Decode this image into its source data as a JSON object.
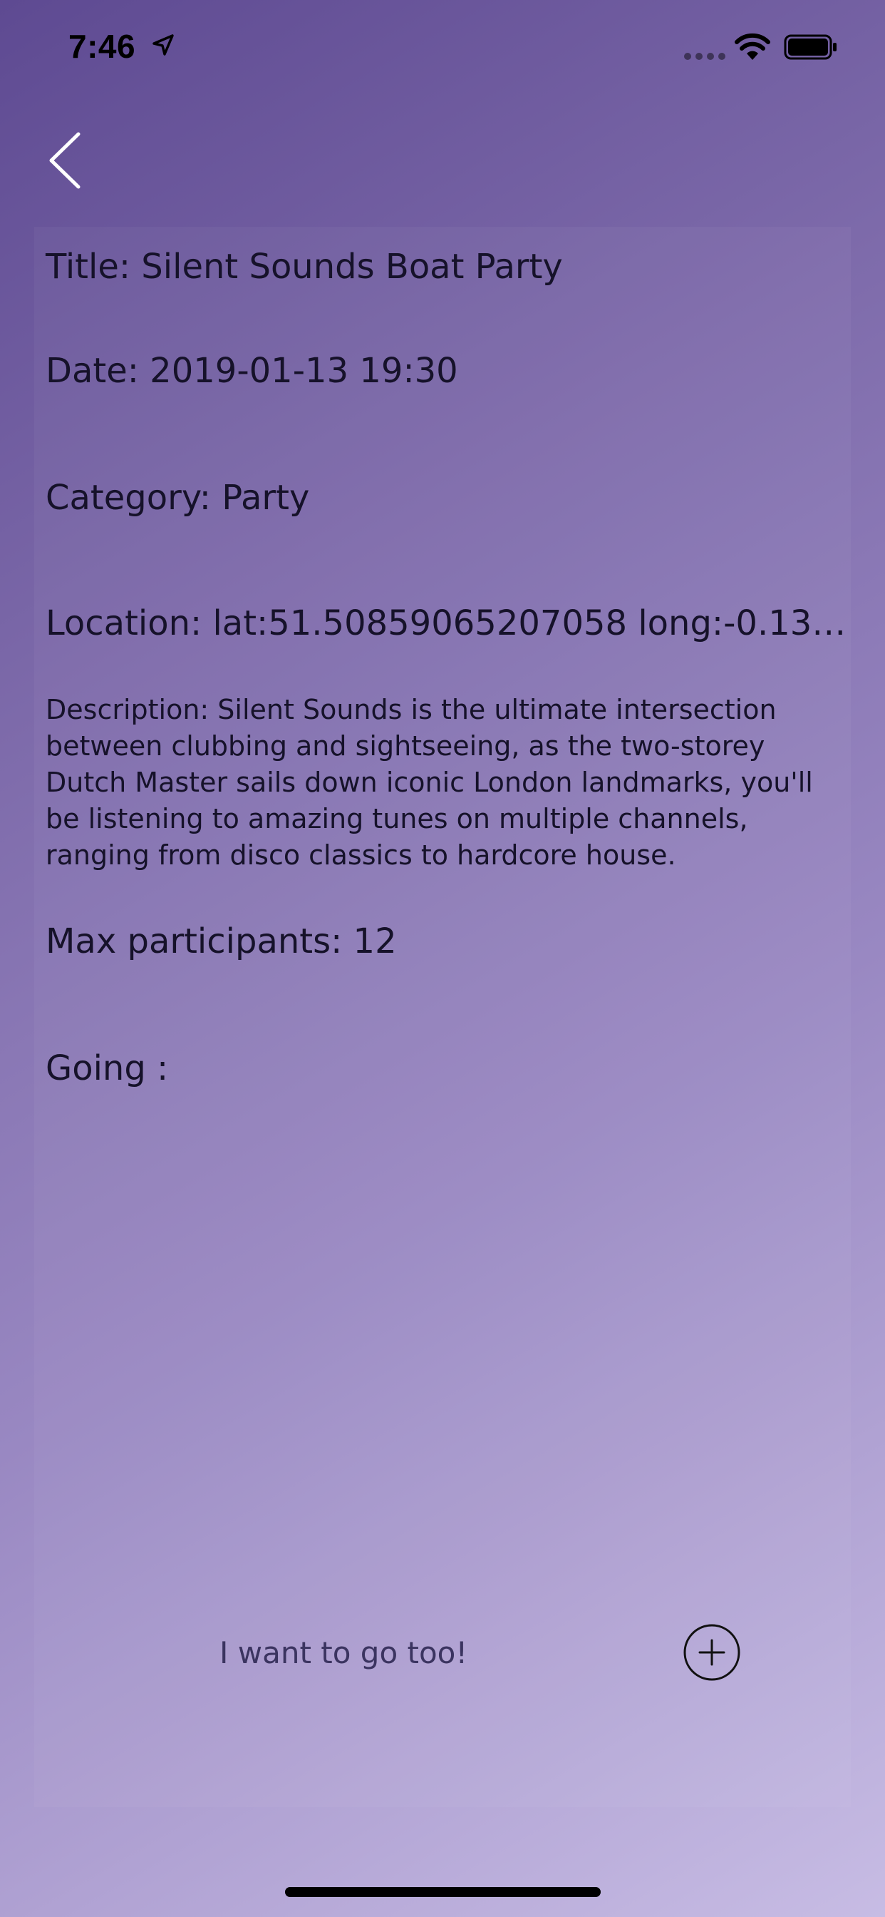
{
  "status_bar": {
    "time": "7:46"
  },
  "event": {
    "title": "Title: Silent Sounds Boat Party",
    "date": "Date: 2019-01-13 19:30",
    "category": "Category: Party",
    "location": "Location: lat:51.50859065207058 long:-0.134…",
    "description": "Description: Silent Sounds is the ultimate intersection between clubbing and sightseeing, as the two-storey Dutch Master sails down iconic London landmarks, you'll be listening to amazing tunes on multiple channels, ranging from disco classics to hardcore house.",
    "max_participants": "Max participants: 12",
    "going": "Going :"
  },
  "join": {
    "label": "I want to go too!",
    "button_icon": "plus-circle-icon"
  },
  "colors": {
    "background_top": "#5e4a92",
    "background_bottom": "#c7bce4",
    "text": "#16122a",
    "join_label": "#3b3460"
  }
}
